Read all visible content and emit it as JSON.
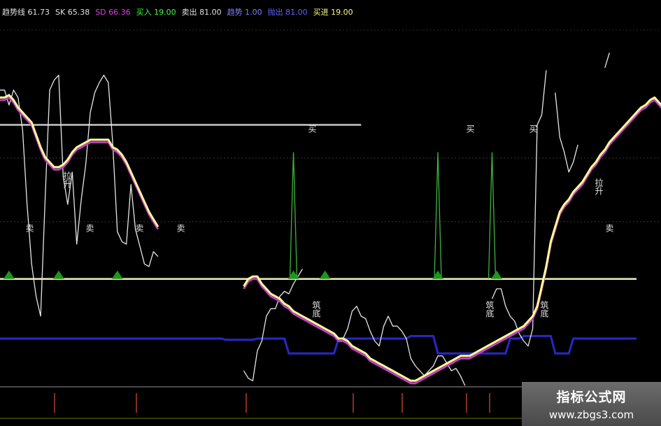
{
  "legend": [
    {
      "label": "趋势线",
      "value": "61.73",
      "color": "#e0e0e0"
    },
    {
      "label": "SK",
      "value": "65.38",
      "color": "#e0e0e0"
    },
    {
      "label": "SD",
      "value": "66.36",
      "color": "#e040e0"
    },
    {
      "label": "买入",
      "value": "19.00",
      "color": "#40ff40"
    },
    {
      "label": "卖出",
      "value": "81.00",
      "color": "#e0e0e0"
    },
    {
      "label": "趋势",
      "value": "1.00",
      "color": "#8080ff"
    },
    {
      "label": "抛出",
      "value": "81.00",
      "color": "#6060ff"
    },
    {
      "label": "买进",
      "value": "19.00",
      "color": "#ffff80"
    }
  ],
  "labels": {
    "buy": "买",
    "sell": "卖",
    "pullup": "拉升",
    "bottom": "筑底"
  },
  "colors": {
    "trend": "#e6e6e6",
    "sk": "#ffff99",
    "sd": "#c040c0",
    "buy": "#3cb43c",
    "line81": "#c8c8c8",
    "line19": "#f0f0b4",
    "zone": "#2828c8",
    "triangle": "#1e961e"
  },
  "watermark": {
    "title": "指标公式网",
    "url": "www.zbgs3.com"
  },
  "chart_data": {
    "type": "line",
    "ylim": [
      -25,
      120
    ],
    "reference_lines": [
      81,
      19
    ],
    "series": [
      {
        "name": "趋势线",
        "values": [
          95,
          95,
          89,
          95,
          92,
          79,
          49,
          25,
          12,
          4,
          51,
          95,
          99,
          101,
          60,
          49,
          62,
          33,
          51,
          65,
          86,
          94,
          98,
          101,
          98,
          73,
          38,
          34,
          33,
          57,
          39,
          32,
          25,
          24,
          30,
          28,
          null,
          null,
          null,
          null,
          null,
          null,
          null,
          null,
          null,
          null,
          null,
          null,
          null,
          null,
          null,
          null,
          null,
          null,
          -18,
          -21,
          -22,
          -10,
          -6,
          4,
          7,
          7,
          12,
          14,
          13,
          17,
          20,
          23,
          null,
          null,
          null,
          null,
          null,
          null,
          null,
          null,
          -5,
          -1,
          6,
          8,
          4,
          3,
          -2,
          -6,
          -8,
          0,
          4,
          0,
          0,
          -2,
          -5,
          -13,
          -16,
          -18,
          -20,
          -18,
          -16,
          -12,
          -12,
          -15,
          -18,
          -17,
          -20,
          -24,
          null,
          null,
          null,
          null,
          null,
          11,
          15,
          15,
          8,
          4,
          2,
          -3,
          -6,
          -8,
          -1,
          81,
          85,
          103,
          null,
          94,
          76,
          70,
          62,
          66,
          73,
          null,
          100,
          null,
          null,
          null,
          104,
          110,
          null,
          null,
          null,
          null,
          null,
          null
        ]
      },
      {
        "name": "SK",
        "values": [
          92,
          92,
          93,
          91,
          88,
          86,
          84,
          82,
          77,
          72,
          68,
          66,
          64,
          64,
          65,
          67,
          70,
          72,
          73,
          74,
          75,
          75,
          75,
          75,
          75,
          72,
          71,
          69,
          66,
          62,
          58,
          54,
          50,
          46,
          43,
          40,
          null,
          null,
          null,
          null,
          null,
          null,
          null,
          null,
          null,
          null,
          null,
          null,
          null,
          null,
          null,
          null,
          null,
          null,
          16,
          19,
          20,
          20,
          17,
          15,
          13,
          12,
          11,
          9,
          8,
          6,
          5,
          4,
          3,
          2,
          1,
          0,
          -1,
          -2,
          -3,
          -5,
          -5,
          -6,
          -8,
          -9,
          -10,
          -11,
          -13,
          -14,
          -15,
          -16,
          -17,
          -18,
          -19,
          -20,
          -21,
          -22,
          -22,
          -21,
          -20,
          -19,
          -18,
          -17,
          -16,
          -15,
          -14,
          -13,
          -12,
          -12,
          -12,
          -11,
          -10,
          -9,
          -8,
          -7,
          -6,
          -5,
          -4,
          -3,
          -2,
          -1,
          0,
          2,
          4,
          8,
          16,
          24,
          34,
          40,
          46,
          49,
          51,
          54,
          56,
          58,
          61,
          64,
          66,
          69,
          71,
          74,
          76,
          78,
          80,
          82,
          84,
          86,
          88,
          89,
          91,
          92,
          90,
          88
        ]
      },
      {
        "name": "SD",
        "values": [
          91,
          91,
          92,
          90,
          87,
          85,
          83,
          81,
          76,
          71,
          67,
          65,
          63,
          63,
          64,
          66,
          69,
          71,
          72,
          73,
          74,
          74,
          74,
          74,
          74,
          71,
          70,
          68,
          65,
          61,
          57,
          53,
          49,
          45,
          42,
          39,
          null,
          null,
          null,
          null,
          null,
          null,
          null,
          null,
          null,
          null,
          null,
          null,
          null,
          null,
          null,
          null,
          null,
          null,
          15,
          18,
          19,
          19,
          16,
          14,
          12,
          11,
          10,
          8,
          7,
          5,
          4,
          3,
          2,
          1,
          0,
          -1,
          -2,
          -3,
          -4,
          -6,
          -6,
          -7,
          -9,
          -10,
          -11,
          -12,
          -14,
          -15,
          -16,
          -17,
          -18,
          -19,
          -20,
          -21,
          -22,
          -23,
          -23,
          -22,
          -21,
          -20,
          -19,
          -18,
          -17,
          -16,
          -15,
          -14,
          -13,
          -13,
          -13,
          -12,
          -11,
          -10,
          -9,
          -8,
          -7,
          -6,
          -5,
          -4,
          -3,
          -2,
          -1,
          1,
          3,
          7,
          15,
          23,
          33,
          39,
          45,
          48,
          50,
          53,
          55,
          57,
          60,
          63,
          65,
          68,
          70,
          73,
          75,
          77,
          79,
          81,
          83,
          85,
          87,
          88,
          90,
          91,
          89,
          87
        ]
      }
    ]
  }
}
